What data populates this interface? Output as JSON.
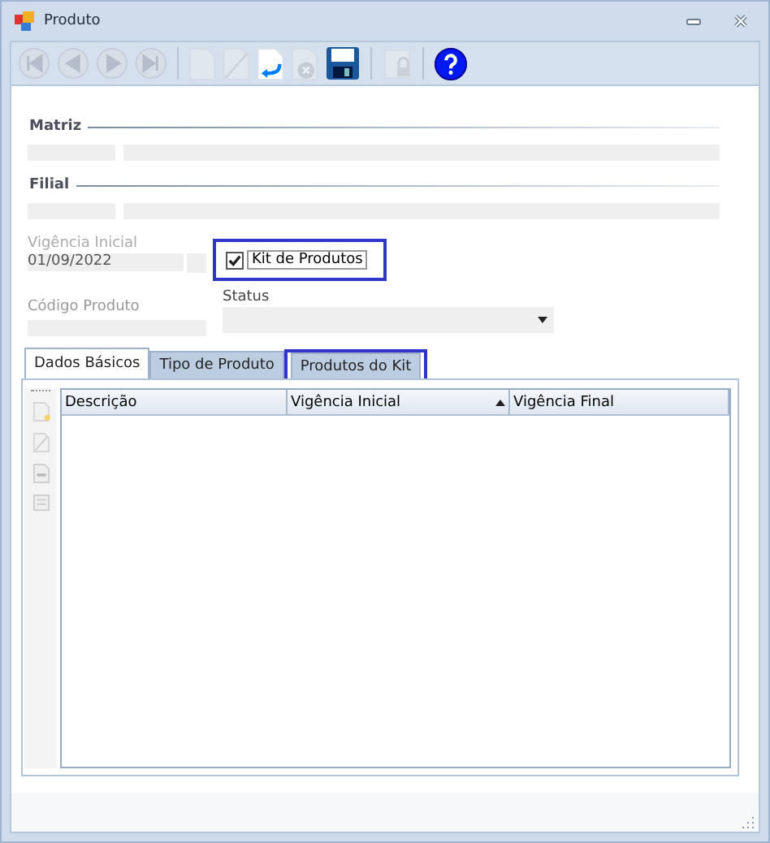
{
  "window": {
    "title": "Produto"
  },
  "toolbar": [
    {
      "kind": "first",
      "disabled": true
    },
    {
      "kind": "prev",
      "disabled": true
    },
    {
      "kind": "next",
      "disabled": true
    },
    {
      "kind": "last",
      "disabled": true
    },
    {
      "kind": "sep"
    },
    {
      "kind": "new",
      "disabled": true
    },
    {
      "kind": "edit",
      "disabled": true
    },
    {
      "kind": "undo",
      "disabled": false
    },
    {
      "kind": "cancel",
      "disabled": true
    },
    {
      "kind": "save",
      "disabled": false
    },
    {
      "kind": "sep"
    },
    {
      "kind": "lock",
      "disabled": true
    },
    {
      "kind": "sep"
    },
    {
      "kind": "help",
      "disabled": false
    }
  ],
  "matriz": {
    "label": "Matriz"
  },
  "filial": {
    "label": "Filial"
  },
  "vigencia_inicial": {
    "label": "Vigência Inicial",
    "value": "01/09/2022"
  },
  "kit_de_produtos": {
    "label": "Kit de Produtos",
    "checked": true,
    "highlighted": true
  },
  "codigo_produto": {
    "label": "Código Produto"
  },
  "status": {
    "label": "Status"
  },
  "tabs": [
    {
      "label": "Dados Básicos",
      "selected": true,
      "highlighted": false
    },
    {
      "label": "Tipo de Produto",
      "selected": false,
      "highlighted": false
    },
    {
      "label": "Produtos do Kit",
      "selected": false,
      "highlighted": true
    }
  ],
  "table": {
    "columns": [
      {
        "label": "Descrição",
        "sorted": false
      },
      {
        "label": "Vigência Inicial",
        "sorted": true
      },
      {
        "label": "Vigência Final",
        "sorted": false
      }
    ]
  }
}
